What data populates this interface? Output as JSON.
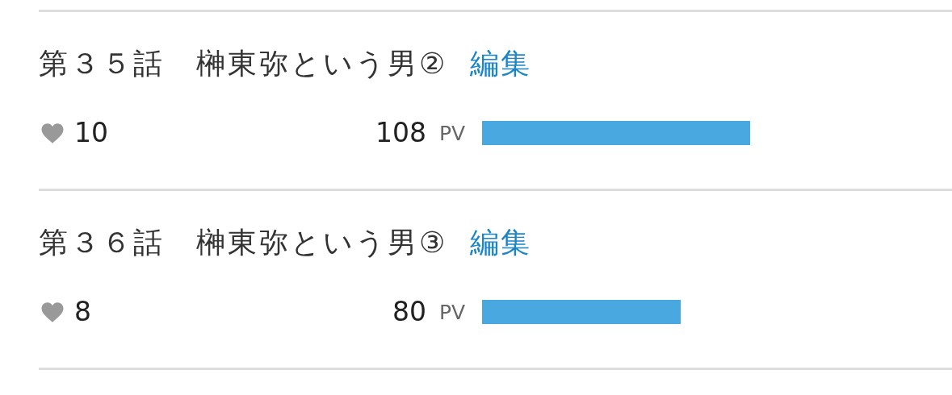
{
  "episodes": [
    {
      "title": "第３５話　榊東弥という男②",
      "edit_link": "編集",
      "likes": "10",
      "views": "108",
      "views_unit": "PV"
    },
    {
      "title": "第３６話　榊東弥という男③",
      "edit_link": "編集",
      "likes": "8",
      "views": "80",
      "views_unit": "PV"
    }
  ]
}
